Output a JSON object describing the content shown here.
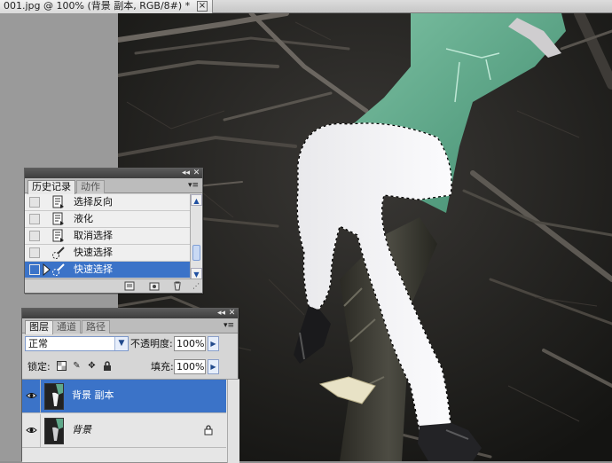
{
  "document": {
    "tab_title": "001.jpg @ 100% (背景 副本, RGB/8#) *",
    "close_glyph": "×"
  },
  "history_panel": {
    "tabs": [
      {
        "label": "历史记录",
        "active": true
      },
      {
        "label": "动作",
        "active": false
      }
    ],
    "items": [
      {
        "label": "选择反向",
        "icon": "history-state-icon",
        "selected": false
      },
      {
        "label": "液化",
        "icon": "history-state-icon",
        "selected": false
      },
      {
        "label": "取消选择",
        "icon": "history-state-icon",
        "selected": false
      },
      {
        "label": "快速选择",
        "icon": "quick-selection-icon",
        "selected": false
      },
      {
        "label": "快速选择",
        "icon": "quick-selection-icon",
        "selected": true
      }
    ],
    "scroll_position": 0.85,
    "footer_buttons": [
      "new-document-from-state-icon",
      "create-snapshot-icon",
      "delete-state-icon"
    ]
  },
  "layers_panel": {
    "tabs": [
      {
        "label": "图层",
        "active": true
      },
      {
        "label": "通道",
        "active": false
      },
      {
        "label": "路径",
        "active": false
      }
    ],
    "blend_mode": "正常",
    "opacity_label": "不透明度:",
    "opacity_value": "100%",
    "lock_label": "锁定:",
    "fill_label": "填充:",
    "fill_value": "100%",
    "layers": [
      {
        "name": "背景 副本",
        "visible": true,
        "selected": true,
        "locked": false,
        "italic": false
      },
      {
        "name": "背景",
        "visible": true,
        "selected": false,
        "locked": true,
        "italic": true
      }
    ]
  },
  "colors": {
    "selection_blue": "#3b73c8",
    "panel_bg": "#d6d6d6",
    "panel_header": "#4a4a4a",
    "dress_green": "#5fa88a"
  }
}
